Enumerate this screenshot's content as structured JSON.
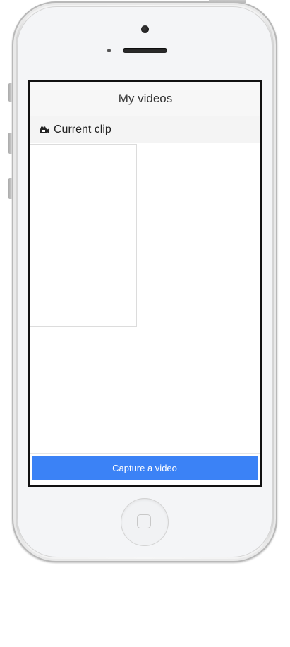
{
  "app": {
    "title": "My videos"
  },
  "section": {
    "label": "Current clip",
    "icon": "video-camera-icon"
  },
  "actions": {
    "capture_label": "Capture a video"
  },
  "colors": {
    "primary": "#3b82f6",
    "navbar_bg": "#f7f7f7",
    "section_bg": "#f4f4f4"
  }
}
